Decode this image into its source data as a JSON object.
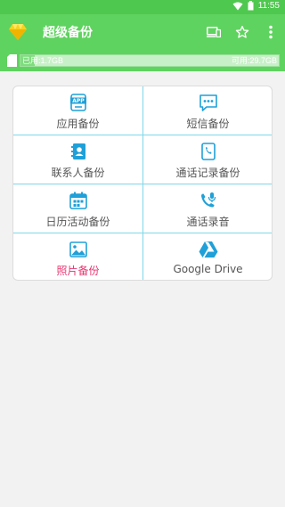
{
  "status_bar": {
    "time": "11:55"
  },
  "app_bar": {
    "title": "超级备份"
  },
  "storage": {
    "used_label": "已用:1.7GB",
    "free_label": "可用:29.7GB",
    "used_fraction": 0.054
  },
  "grid": {
    "items": [
      {
        "label": "应用备份",
        "icon": "app-icon",
        "icon_text": "APP"
      },
      {
        "label": "短信备份",
        "icon": "sms-icon"
      },
      {
        "label": "联系人备份",
        "icon": "contacts-icon"
      },
      {
        "label": "通话记录备份",
        "icon": "call-log-icon"
      },
      {
        "label": "日历活动备份",
        "icon": "calendar-icon"
      },
      {
        "label": "通话录音",
        "icon": "call-recording-icon"
      },
      {
        "label": "照片备份",
        "icon": "photo-icon"
      },
      {
        "label": "Google Drive",
        "icon": "google-drive-icon"
      }
    ]
  },
  "colors": {
    "primary": "#5fd35f",
    "status_bar": "#4fc84f",
    "icon_blue": "#1fa0d8",
    "highlight_pink": "#e8336e"
  }
}
